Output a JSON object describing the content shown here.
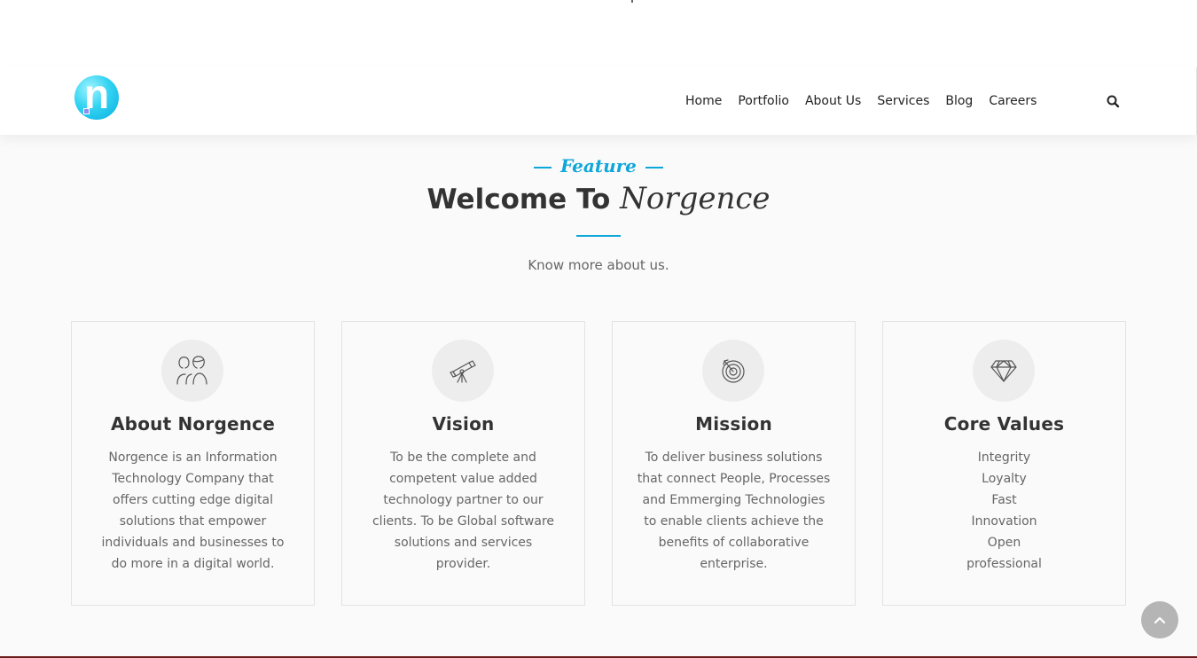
{
  "nav": {
    "items": [
      "Home",
      "Portfolio",
      "About Us",
      "Services",
      "Blog",
      "Careers"
    ],
    "search_icon": "search-icon"
  },
  "logo": {
    "letter": "n"
  },
  "hero": {
    "feature_label": "Feature",
    "welcome_prefix": "Welcome To",
    "welcome_brand": "Norgence",
    "subtitle": "Know more about us."
  },
  "cards": [
    {
      "icon": "team-icon",
      "title": "About Norgence",
      "text": "Norgence is an Information\nTechnology Company that\noffers cutting edge digital\nsolutions that empower\nindividuals and businesses to\ndo more in a digital world."
    },
    {
      "icon": "telescope-icon",
      "title": "Vision",
      "text": "To be the complete and\ncompetent value added\ntechnology partner to our\nclients. To be Global software\nsolutions and services\nprovider."
    },
    {
      "icon": "target-icon",
      "title": "Mission",
      "text": "To deliver business solutions\nthat connect People, Processes\nand Emmerging Technologies\nto enable clients achieve the\nbenefits of collaborative\nenterprise."
    },
    {
      "icon": "diamond-icon",
      "title": "Core Values",
      "text": "Integrity\nLoyalty\nFast\nInnovation\nOpen\nprofessional"
    }
  ],
  "colors": {
    "accent": "#0fa6d9",
    "heading": "#333333",
    "body_text": "#666666",
    "scroll_button": "#b5b5b5"
  },
  "scroll_top_icon": "chevron-up-icon"
}
